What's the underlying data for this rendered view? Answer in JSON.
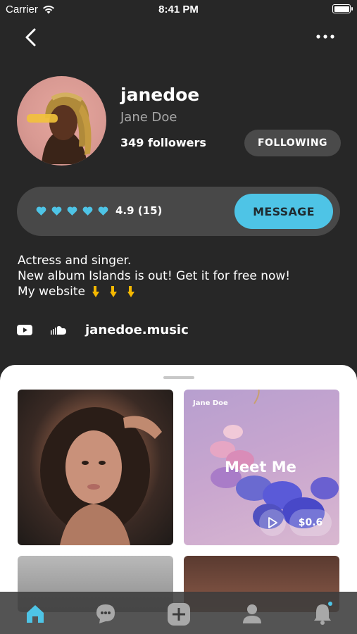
{
  "status_bar": {
    "carrier": "Carrier",
    "time": "8:41 PM"
  },
  "profile": {
    "username": "janedoe",
    "full_name": "Jane Doe",
    "followers": "349 followers",
    "following_label": "FOLLOWING"
  },
  "rating": {
    "hearts": 5,
    "text": "4.9 (15)",
    "message_label": "MESSAGE"
  },
  "bio": {
    "line1": "Actress and singer.",
    "line2": "New album Islands is out! Get it for free now!",
    "line3": "My website"
  },
  "links": {
    "website": "janedoe.music",
    "icons": [
      "youtube-icon",
      "soundcloud-icon"
    ]
  },
  "posts": [
    {
      "type": "photo"
    },
    {
      "type": "album",
      "artist": "Jane Doe",
      "title": "Meet Me",
      "price": "$0.6"
    },
    {
      "type": "photo"
    },
    {
      "type": "photo"
    }
  ],
  "tab_bar": {
    "items": [
      "home-icon",
      "chat-icon",
      "add-icon",
      "profile-icon",
      "notification-icon"
    ],
    "active": "home-icon"
  },
  "colors": {
    "background": "#272727",
    "accent": "#4ec4e6",
    "card": "#484848",
    "sheet": "#ffffff"
  }
}
